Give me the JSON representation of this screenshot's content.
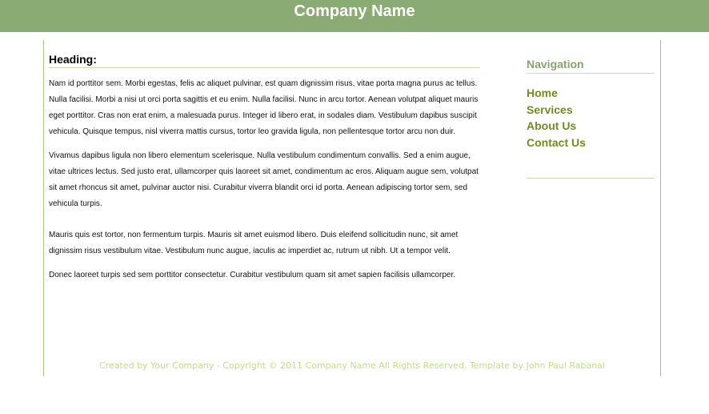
{
  "header": {
    "title": "Company Name"
  },
  "main": {
    "heading": "Heading:",
    "paragraphs": [
      "Nam id porttitor sem. Morbi egestas, felis ac aliquet pulvinar, est quam dignissim risus, vitae porta magna purus ac tellus. Nulla facilisi. Morbi a nisi ut orci porta sagittis et eu enim. Nulla facilisi. Nunc in arcu tortor. Aenean volutpat aliquet mauris eget porttitor. Cras non erat enim, a malesuada purus. Integer id libero erat, in sodales diam. Vestibulum dapibus suscipit vehicula. Quisque tempus, nisl viverra mattis cursus, tortor leo gravida ligula, non pellentesque tortor arcu non duir.",
      "Vivamus dapibus ligula non libero elementum scelerisque. Nulla vestibulum condimentum convallis. Sed a enim augue, vitae ultrices lectus. Sed justo erat, ullamcorper quis laoreet sit amet, condimentum ac eros. Aliquam augue sem, volutpat sit amet rhoncus sit amet, pulvinar auctor nisi. Curabitur viverra blandit orci id porta. Aenean adipiscing tortor sem, sed vehicula turpis.",
      "Mauris quis est tortor, non fermentum turpis. Mauris sit amet euismod libero. Duis eleifend sollicitudin nunc, sit amet dignissim risus vestibulum vitae. Vestibulum nunc augue, iaculis ac imperdiet ac, rutrum ut nibh. Ut a tempor velit.",
      "Donec laoreet turpis sed sem porttitor consectetur. Curabitur vestibulum quam sit amet sapien facilisis ullamcorper."
    ]
  },
  "sidebar": {
    "title": "Navigation",
    "items": [
      {
        "label": "Home"
      },
      {
        "label": "Services"
      },
      {
        "label": "About Us"
      },
      {
        "label": "Contact Us"
      }
    ]
  },
  "footer": {
    "text": "Created by Your Company - Copyright © 2011 Company Name All Rights Reserved.  Template by John Paul Rabanal"
  },
  "colors": {
    "header_bg": "#8aab74",
    "nav_link": "#6f8d1e",
    "nav_title": "#8aa172",
    "footer_text": "#c5da8a",
    "divider": "#cfdcb0"
  }
}
